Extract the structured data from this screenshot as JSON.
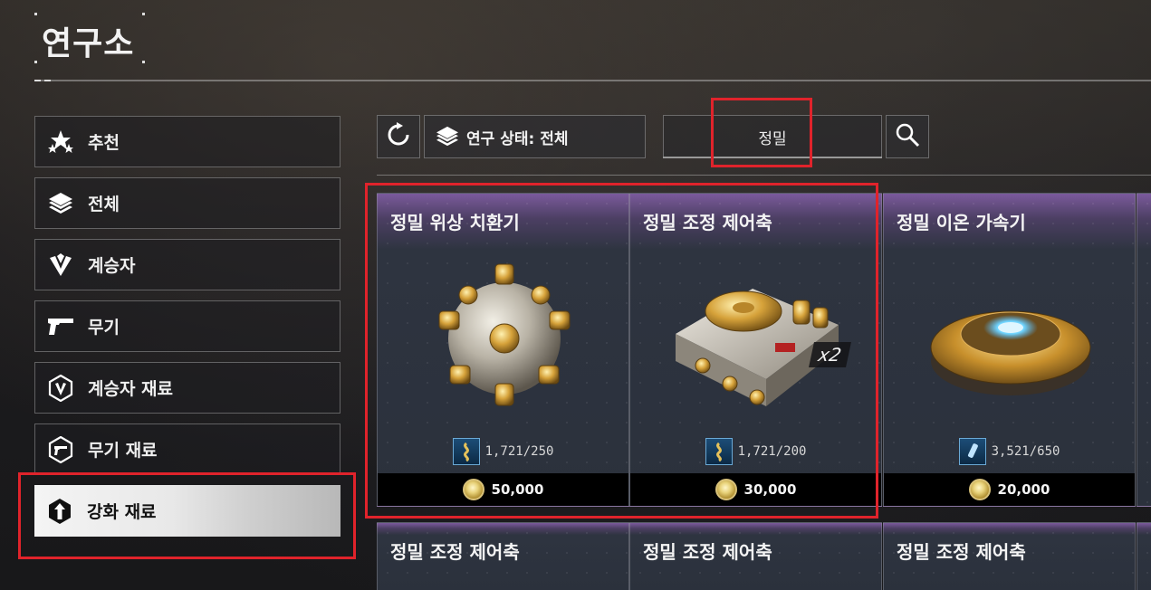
{
  "page": {
    "title": "연구소"
  },
  "sidebar": {
    "items": [
      {
        "label": "추천",
        "icon": "stars-icon"
      },
      {
        "label": "전체",
        "icon": "layers-icon"
      },
      {
        "label": "계승자",
        "icon": "descendant-emblem-icon"
      },
      {
        "label": "무기",
        "icon": "pistol-icon"
      },
      {
        "label": "계승자 재료",
        "icon": "descendant-material-icon"
      },
      {
        "label": "무기 재료",
        "icon": "weapon-material-icon"
      },
      {
        "label": "강화 재료",
        "icon": "enhancement-material-icon",
        "active": true
      }
    ]
  },
  "toolbar": {
    "refresh_icon": "refresh-icon",
    "filter_label": "연구 상태: 전체",
    "filter_icon": "layers-icon",
    "search_value": "정밀",
    "search_icon": "magnifier-icon"
  },
  "cards": [
    {
      "title": "정밀 위상 치환기",
      "stock": "1,721/250",
      "price": "50,000",
      "qty": "",
      "image": "golden-spiked-sphere"
    },
    {
      "title": "정밀 조정 제어축",
      "stock": "1,721/200",
      "price": "30,000",
      "qty": "x2",
      "image": "golden-control-module"
    },
    {
      "title": "정밀 이온 가속기",
      "stock": "3,521/650",
      "price": "20,000",
      "qty": "",
      "image": "golden-ion-disc"
    },
    {
      "title": "정밀 조정 제어축"
    },
    {
      "title": "정밀 조정 제어축"
    },
    {
      "title": "정밀 조정 제어축"
    }
  ],
  "colors": {
    "highlight": "#e0232b",
    "card_top": "#7b5a9c",
    "active_tab": "#f0f0f0"
  }
}
